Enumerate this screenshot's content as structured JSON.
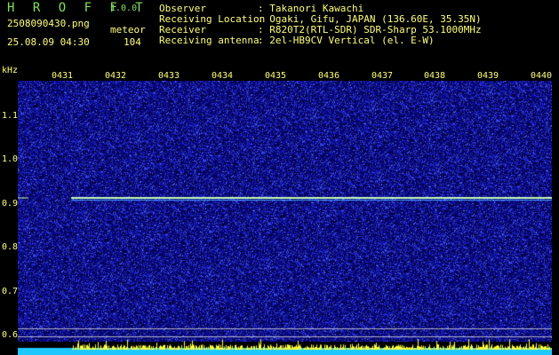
{
  "app": {
    "name": "H R O F F T",
    "version": "1.0.0",
    "file_name": "2508090430.png",
    "detection_type": "meteor",
    "timestamp": "25.08.09 04:30",
    "count": "104"
  },
  "station": [
    {
      "key": "Observer",
      "value": ": Takanori Kawachi"
    },
    {
      "key": "Receiving Location",
      "value": ": Ogaki, Gifu, JAPAN (136.60E, 35.35N)"
    },
    {
      "key": "Receiver",
      "value": ": R820T2(RTL-SDR) SDR-Sharp 53.1000MHz"
    },
    {
      "key": "Receiving antenna",
      "value": ": 2el-HB9CV Vertical (el. E-W)"
    }
  ],
  "axes": {
    "freq_unit": "kHz",
    "time_ticks": [
      "0431",
      "0432",
      "0433",
      "0434",
      "0435",
      "0436",
      "0437",
      "0438",
      "0439",
      "0440"
    ],
    "freq_ticks": [
      "1.1",
      "1.0",
      "0.9",
      "0.8",
      "0.7",
      "0.6"
    ]
  },
  "colors": {
    "background": "#000000",
    "label": "#ffff7a",
    "title": "#7fe05a",
    "noise_low": "#0a0a6e",
    "noise_high": "#3a4ad8",
    "signal": "#c8ffb4",
    "spectrum_bar": "#ffff3c"
  }
}
